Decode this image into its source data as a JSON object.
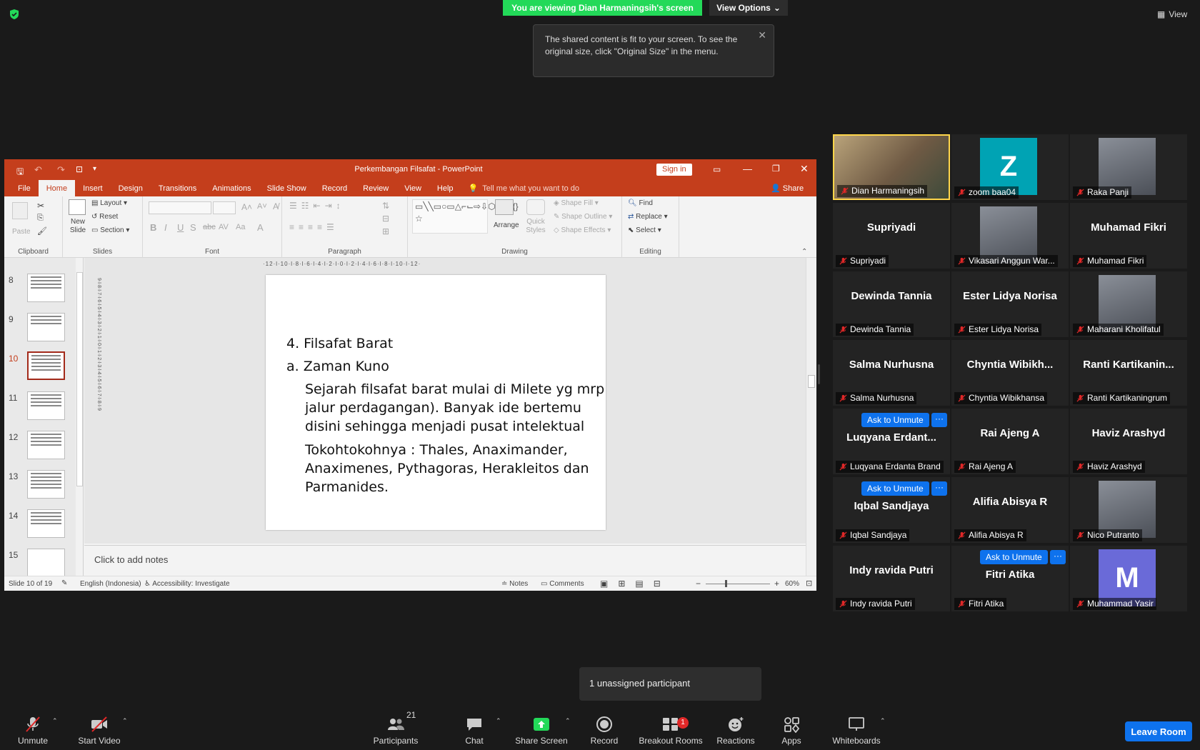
{
  "zoom": {
    "banner": "You are viewing Dian Harmaningsih's screen",
    "view_options": "View Options",
    "view_button": "View",
    "tooltip": "The shared content is fit to your screen. To see the original size, click \"Original Size\" in the menu.",
    "unassigned": "1 unassigned participant",
    "toolbar": {
      "unmute": "Unmute",
      "start_video": "Start Video",
      "participants": "Participants",
      "participants_count": "21",
      "chat": "Chat",
      "share_screen": "Share Screen",
      "record": "Record",
      "breakout_rooms": "Breakout Rooms",
      "breakout_badge": "1",
      "reactions": "Reactions",
      "apps": "Apps",
      "whiteboards": "Whiteboards",
      "leave_room": "Leave Room"
    },
    "ask_to_unmute": "Ask to Unmute",
    "more": "···"
  },
  "colors": {
    "zoom_green": "#23d959",
    "zoom_blue": "#0e72ed",
    "ppt_red": "#c43e1c",
    "speaker_border": "#ffd64a"
  },
  "participants": [
    {
      "name": "Dian Harmaningsih",
      "big": "",
      "avatar": "video",
      "speaker": true
    },
    {
      "name": "zoom baa04",
      "big": "",
      "avatar": "Z",
      "avatar_color": "#00a3b4"
    },
    {
      "name": "Raka Panji",
      "big": "",
      "avatar": "photo"
    },
    {
      "name": "Supriyadi",
      "big": "Supriyadi"
    },
    {
      "name": "Vikasari Anggun War...",
      "big": "",
      "avatar": "photo"
    },
    {
      "name": "Muhamad Fikri",
      "big": "Muhamad Fikri"
    },
    {
      "name": "Dewinda Tannia",
      "big": "Dewinda Tannia"
    },
    {
      "name": "Ester Lidya Norisa",
      "big": "Ester Lidya Norisa"
    },
    {
      "name": "Maharani Kholifatul",
      "big": "",
      "avatar": "photo"
    },
    {
      "name": "Salma Nurhusna",
      "big": "Salma Nurhusna"
    },
    {
      "name": "Chyntia Wibikhansa",
      "big": "Chyntia  Wibikh..."
    },
    {
      "name": "Ranti Kartikaningrum",
      "big": "Ranti  Kartikanin..."
    },
    {
      "name": "Luqyana Erdanta Brand",
      "big": "Luqyana  Erdant...",
      "ask": true
    },
    {
      "name": "Rai Ajeng A",
      "big": "Rai Ajeng A"
    },
    {
      "name": "Haviz Arashyd",
      "big": "Haviz Arashyd"
    },
    {
      "name": "Iqbal Sandjaya",
      "big": "Iqbal Sandjaya",
      "ask": true
    },
    {
      "name": "Alifia Abisya R",
      "big": "Alifia Abisya R"
    },
    {
      "name": "Nico Putranto",
      "big": "",
      "avatar": "photo"
    },
    {
      "name": "Indy ravida Putri",
      "big": "Indy ravida Putri"
    },
    {
      "name": "Fitri Atika",
      "big": "Fitri Atika",
      "ask": true
    },
    {
      "name": "Muhammad Yasir",
      "big": "",
      "avatar": "M",
      "avatar_color": "#6a6ad8"
    }
  ],
  "ppt": {
    "title": "Perkembangan Filsafat  -  PowerPoint",
    "sign_in": "Sign in",
    "share": "Share",
    "tell_me": "Tell me what you want to do",
    "tabs": [
      "File",
      "Home",
      "Insert",
      "Design",
      "Transitions",
      "Animations",
      "Slide Show",
      "Record",
      "Review",
      "View",
      "Help"
    ],
    "ribbon": {
      "paste": "Paste",
      "clipboard": "Clipboard",
      "new_slide": "New Slide",
      "layout": "Layout",
      "reset": "Reset",
      "section": "Section",
      "slides": "Slides",
      "font": "Font",
      "paragraph": "Paragraph",
      "arrange": "Arrange",
      "quick_styles": "Quick Styles",
      "shape_fill": "Shape Fill",
      "shape_outline": "Shape Outline",
      "shape_effects": "Shape Effects",
      "drawing": "Drawing",
      "find": "Find",
      "replace": "Replace",
      "select": "Select",
      "editing": "Editing"
    },
    "thumb_numbers": [
      "8",
      "9",
      "10",
      "11",
      "12",
      "13",
      "14",
      "15"
    ],
    "active_slide": "10",
    "ruler": "·12·l·10·l·8·l·6·l·4·l·2·l·0·l·2·l·4·l·6·l·8·l·10·l·12·",
    "vruler": "9·l·8·l·7·l·6·l·5·l·4·l·3·l·2·l·1·l·0·l·1·l·2·l·3·l·4·l·5·l·6·l·7·l·8·l·9",
    "slide": {
      "line1": "4. Filsafat Barat",
      "line2": "a.  Zaman Kuno",
      "para1_l1": " Sejarah filsafat barat mulai di Milete yg mrp",
      "para1_l2": "jalur perdagangan). Banyak ide bertemu",
      "para1_l3": "disini sehingga menjadi pusat intelektual",
      "para2_l1": " Tokohtokohnya : Thales, Anaximander,",
      "para2_l2": "Anaximenes, Pythagoras, Herakleitos dan",
      "para2_l3": "Parmanides."
    },
    "notes": "Click to add notes",
    "status": {
      "slide": "Slide 10 of 19",
      "language": "English (Indonesia)",
      "accessibility": "Accessibility: Investigate",
      "notes": "Notes",
      "comments": "Comments",
      "zoom": "60%"
    }
  }
}
